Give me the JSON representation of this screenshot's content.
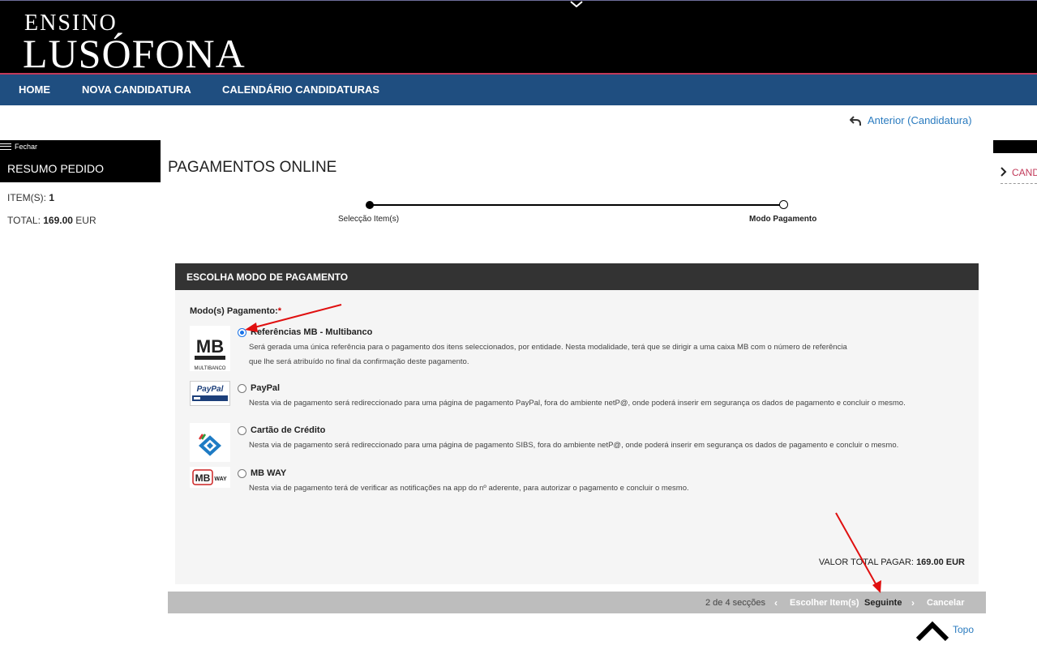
{
  "header": {
    "logo_line1": "ENSINO",
    "logo_line2": "LUSÓFONA"
  },
  "nav": {
    "items": [
      "HOME",
      "NOVA CANDIDATURA",
      "CALENDÁRIO CANDIDATURAS"
    ]
  },
  "back_link": {
    "label": "Anterior (Candidatura)",
    "icon": "undo-arrow-icon"
  },
  "sidebar": {
    "close_label": "Fechar",
    "title": "RESUMO PEDIDO",
    "items_label": "ITEM(S):",
    "items_value": "1",
    "total_label": "TOTAL:",
    "total_value": "169.00",
    "total_currency": "EUR"
  },
  "right_sidebar": {
    "link_label": "CAND"
  },
  "page": {
    "title": "PAGAMENTOS ONLINE"
  },
  "steps": [
    {
      "label": "Selecção Item(s)",
      "done": true
    },
    {
      "label": "Modo Pagamento",
      "done": false,
      "current": true
    }
  ],
  "payment_box": {
    "title": "ESCOLHA MODO DE PAGAMENTO",
    "field_label": "Modo(s) Pagamento:",
    "required_mark": "*",
    "options": [
      {
        "name": "Referências MB - Multibanco",
        "selected": true,
        "logo": "multibanco-logo",
        "logo_text": "MB",
        "logo_subtext": "MULTIBANCO",
        "desc_line1": "Será gerada uma única referência para o pagamento dos itens seleccionados, por entidade. Nesta modalidade, terá que se dirigir a uma caixa MB com o número de referência",
        "desc_line2": "que lhe será atribuído no final da confirmação deste pagamento."
      },
      {
        "name": "PayPal",
        "selected": false,
        "logo": "paypal-logo",
        "logo_text": "PayPal",
        "desc_line1": "Nesta via de pagamento será redireccionado para uma página de pagamento PayPal, fora do ambiente netP@, onde poderá inserir em segurança os dados de pagamento e concluir o mesmo."
      },
      {
        "name": "Cartão de Crédito",
        "selected": false,
        "logo": "sibs-card-logo",
        "desc_line1": "Nesta via de pagamento será redireccionado para uma página de pagamento SIBS, fora do ambiente netP@, onde poderá inserir em segurança os dados de pagamento e concluir o mesmo."
      },
      {
        "name": "MB WAY",
        "selected": false,
        "logo": "mbway-logo",
        "logo_text": "MB",
        "logo_subtext": "WAY",
        "desc_line1": "Nesta via de pagamento terá de verificar as notificações na app do nº aderente, para autorizar o pagamento e concluir o mesmo."
      }
    ],
    "total_label": "VALOR TOTAL PAGAR:",
    "total_value": "169.00 EUR"
  },
  "footer_nav": {
    "sections": "2 de 4 secções",
    "back_label": "Escolher Item(s)",
    "next_label": "Seguinte",
    "cancel_label": "Cancelar"
  },
  "top_link": {
    "label": "Topo"
  },
  "colors": {
    "header_bg": "#000000",
    "nav_bg": "#1f4e80",
    "link": "#2a7bbf",
    "accent": "#c23a5a",
    "annotation_arrow": "#e01010"
  }
}
